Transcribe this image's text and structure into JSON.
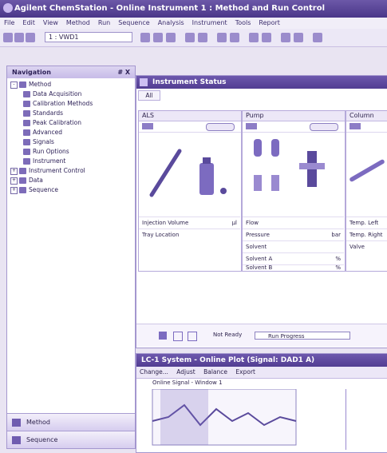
{
  "window": {
    "title": "Agilent ChemStation - Online Instrument 1 : Method and Run Control"
  },
  "menu": [
    "File",
    "Edit",
    "View",
    "Method",
    "Run",
    "Sequence",
    "Analysis",
    "Instrument",
    "Tools",
    "Report"
  ],
  "toolbar": {
    "selected": "1 : VWD1"
  },
  "nav": {
    "title": "Navigation",
    "pin": "# X",
    "tree": [
      {
        "label": "Method",
        "level": 0,
        "toggle": "-"
      },
      {
        "label": "Data Acquisition",
        "level": 1
      },
      {
        "label": "Calibration Methods",
        "level": 1
      },
      {
        "label": "Standards",
        "level": 1
      },
      {
        "label": "Peak Calibration",
        "level": 1
      },
      {
        "label": "Advanced",
        "level": 1
      },
      {
        "label": "Signals",
        "level": 1
      },
      {
        "label": "Run Options",
        "level": 1
      },
      {
        "label": "Instrument",
        "level": 1
      },
      {
        "label": "Instrument Control",
        "level": 0,
        "toggle": "+"
      },
      {
        "label": "Data",
        "level": 0,
        "toggle": "+"
      },
      {
        "label": "Sequence",
        "level": 0,
        "toggle": "+"
      }
    ],
    "buttons": [
      "Method",
      "Sequence"
    ]
  },
  "instrument_status": {
    "title": "Instrument Status",
    "tab_all": "All",
    "modules": [
      {
        "name": "ALS",
        "props": [
          {
            "label": "Injection Volume",
            "value": "",
            "unit": "µl"
          },
          {
            "label": "Tray Location",
            "value": "",
            "unit": ""
          }
        ]
      },
      {
        "name": "Pump",
        "props": [
          {
            "label": "Flow",
            "value": "",
            "unit": ""
          },
          {
            "label": "Pressure",
            "value": "",
            "unit": "bar"
          },
          {
            "label": "Solvent",
            "value": "",
            "unit": ""
          },
          {
            "label": "Solvent A",
            "value": "",
            "unit": "%"
          },
          {
            "label": "Solvent B",
            "value": "",
            "unit": "%"
          }
        ]
      },
      {
        "name": "Column",
        "props": [
          {
            "label": "Temp. Left",
            "value": "",
            "unit": ""
          },
          {
            "label": "Temp. Right",
            "value": "",
            "unit": ""
          },
          {
            "label": "Valve",
            "value": "",
            "unit": ""
          }
        ]
      }
    ],
    "footer": {
      "status": "Not Ready",
      "progress_label": "Run Progress"
    }
  },
  "lc_systems": {
    "title": "LC-1 System - Online Plot (Signal: DAD1 A)",
    "tools": [
      "Change...",
      "Adjust",
      "Balance",
      "Export"
    ],
    "plot_title": "Online Signal - Window 1"
  },
  "colors": {
    "accent": "#523d92",
    "header": "#6d58ad",
    "panel": "#e9e4f2"
  }
}
